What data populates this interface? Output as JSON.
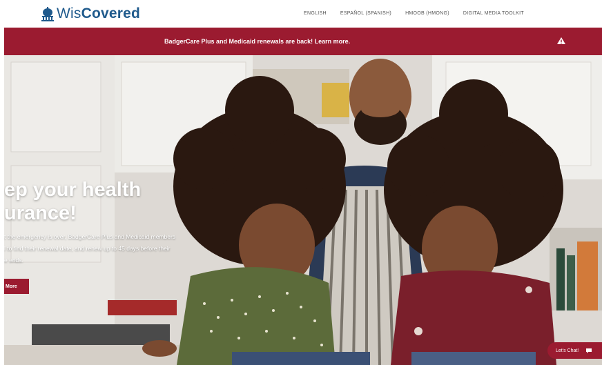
{
  "header": {
    "logo_prefix": "Wis",
    "logo_suffix": "Covered",
    "nav": [
      "English",
      "Español (Spanish)",
      "Hmoob (Hmong)",
      "Digital Media Toolkit"
    ]
  },
  "banner": {
    "text": "BadgerCare Plus and Medicaid renewals are back! Learn more."
  },
  "hero": {
    "title_line1": "ep your health",
    "title_line2": "urance!",
    "desc_line1": "t the emergency is over, BadgerCare Plus and Medicaid members",
    "desc_line2": "l to find their renewal date, and renew up to 45 days before their",
    "desc_line3": "e ends.",
    "button_label": "More"
  },
  "chat": {
    "label": "Let's Chat!"
  },
  "colors": {
    "brand_red": "#9b1b30",
    "logo_blue": "#1f5a8c"
  },
  "icons": [
    "capitol-logo-icon",
    "warning-icon",
    "chat-bubble-icon"
  ]
}
